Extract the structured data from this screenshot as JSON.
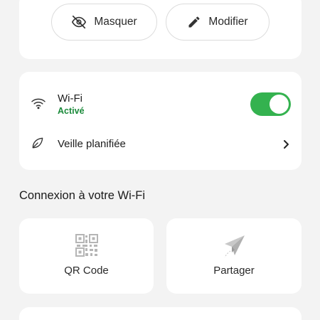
{
  "actions": {
    "hide_label": "Masquer",
    "edit_label": "Modifier"
  },
  "wifi": {
    "title": "Wi-Fi",
    "status": "Activé",
    "enabled": true,
    "status_color": "#1a8a3a",
    "toggle_color": "#34b24f"
  },
  "sleep": {
    "title": "Veille planifiée"
  },
  "connect": {
    "section_title": "Connexion à votre Wi-Fi",
    "tiles": [
      {
        "label": "QR Code",
        "icon": "qr-code-icon"
      },
      {
        "label": "Partager",
        "icon": "paper-plane-icon"
      }
    ]
  }
}
